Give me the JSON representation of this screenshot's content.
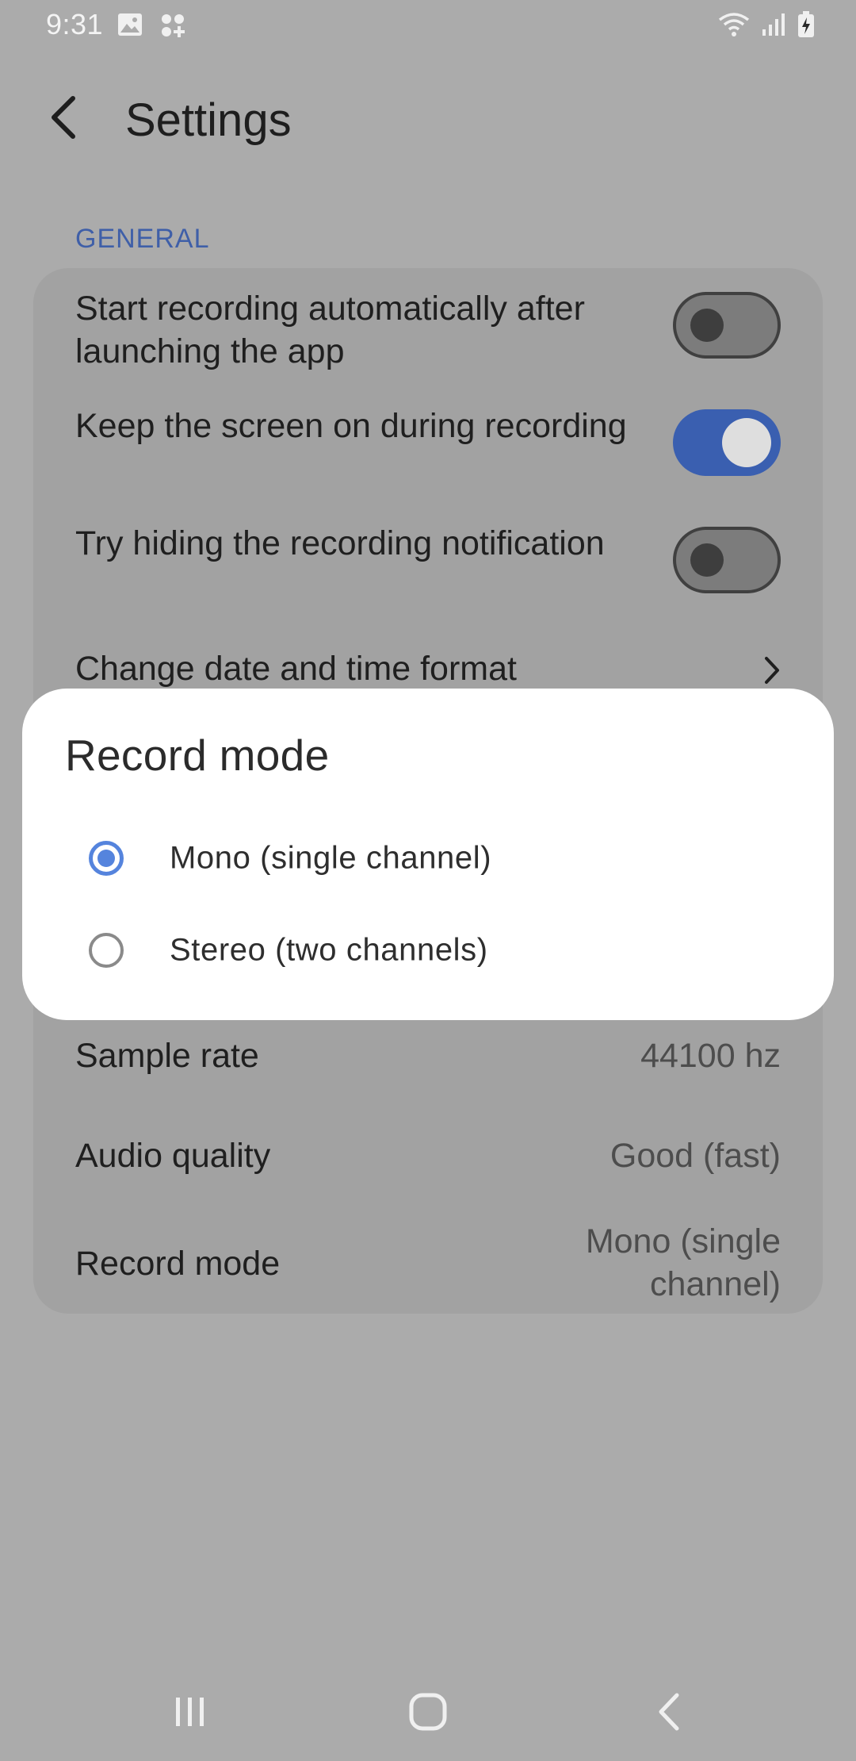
{
  "status_bar": {
    "time": "9:31",
    "left_icons": [
      "image-icon",
      "apps-icon"
    ],
    "right_icons": [
      "wifi-icon",
      "signal-icon",
      "battery-charging-icon"
    ]
  },
  "app_bar": {
    "back_icon": "back-arrow-icon",
    "title": "Settings"
  },
  "general": {
    "header": "GENERAL",
    "items": [
      {
        "label": "Start recording automatically after launching the app",
        "type": "toggle",
        "on": false
      },
      {
        "label": "Keep the screen on during recording",
        "type": "toggle",
        "on": true
      },
      {
        "label": "Try hiding the recording notification",
        "type": "toggle",
        "on": false
      },
      {
        "label": "Change date and time format",
        "type": "link"
      },
      {
        "label": "Sample rate",
        "value": "44100 hz"
      },
      {
        "label": "Audio quality",
        "value": "Good (fast)"
      },
      {
        "label": "Record mode",
        "value": "Mono (single channel)"
      }
    ]
  },
  "dialog": {
    "title": "Record mode",
    "options": [
      {
        "label": "Mono (single channel)",
        "selected": true
      },
      {
        "label": "Stereo (two channels)",
        "selected": false
      }
    ]
  },
  "nav_bar": {
    "icons": [
      "recent-apps-icon",
      "home-icon",
      "back-icon"
    ]
  },
  "colors": {
    "accent": "#3a5fb0",
    "radio_accent": "#5584dd",
    "section_header": "#3f5fa8",
    "scrim_background": "#ababab",
    "dialog_background": "#ffffff"
  }
}
